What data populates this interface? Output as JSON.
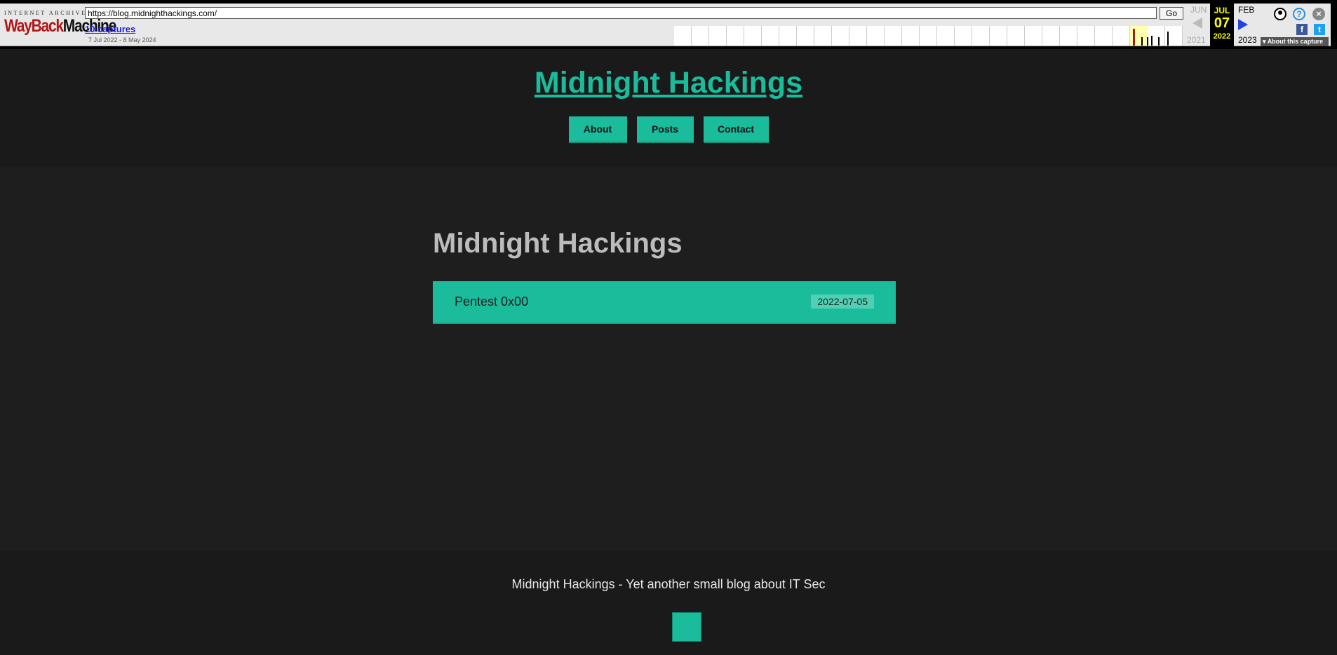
{
  "wayback": {
    "logo_top": "INTERNET ARCHIVE",
    "logo_way": "WayBack",
    "logo_machine": "Machine",
    "url": "https://blog.midnighthackings.com/",
    "go_label": "Go",
    "captures": "10 captures",
    "range": "7 Jul 2022 - 8 May 2024",
    "prev_month": "JUN",
    "prev_year": "2021",
    "current_month": "JUL",
    "current_day": "07",
    "current_year": "2022",
    "next_month": "FEB",
    "next_year": "2023",
    "about_capture": "About this capture",
    "colors": {
      "toolbar_bg": "#e8e8e8",
      "current_bg": "#000000",
      "current_text": "#ffff00"
    }
  },
  "site": {
    "title": "Midnight Hackings",
    "nav": [
      {
        "label": "About"
      },
      {
        "label": "Posts"
      },
      {
        "label": "Contact"
      }
    ],
    "main_heading": "Midnight Hackings",
    "posts": [
      {
        "title": "Pentest 0x00",
        "date": "2022-07-05"
      }
    ],
    "footer_text": "Midnight Hackings - Yet another small blog about IT Sec",
    "colors": {
      "accent": "#1abc9c",
      "background": "#1e1e1e",
      "heading": "#bcbcbc"
    }
  }
}
